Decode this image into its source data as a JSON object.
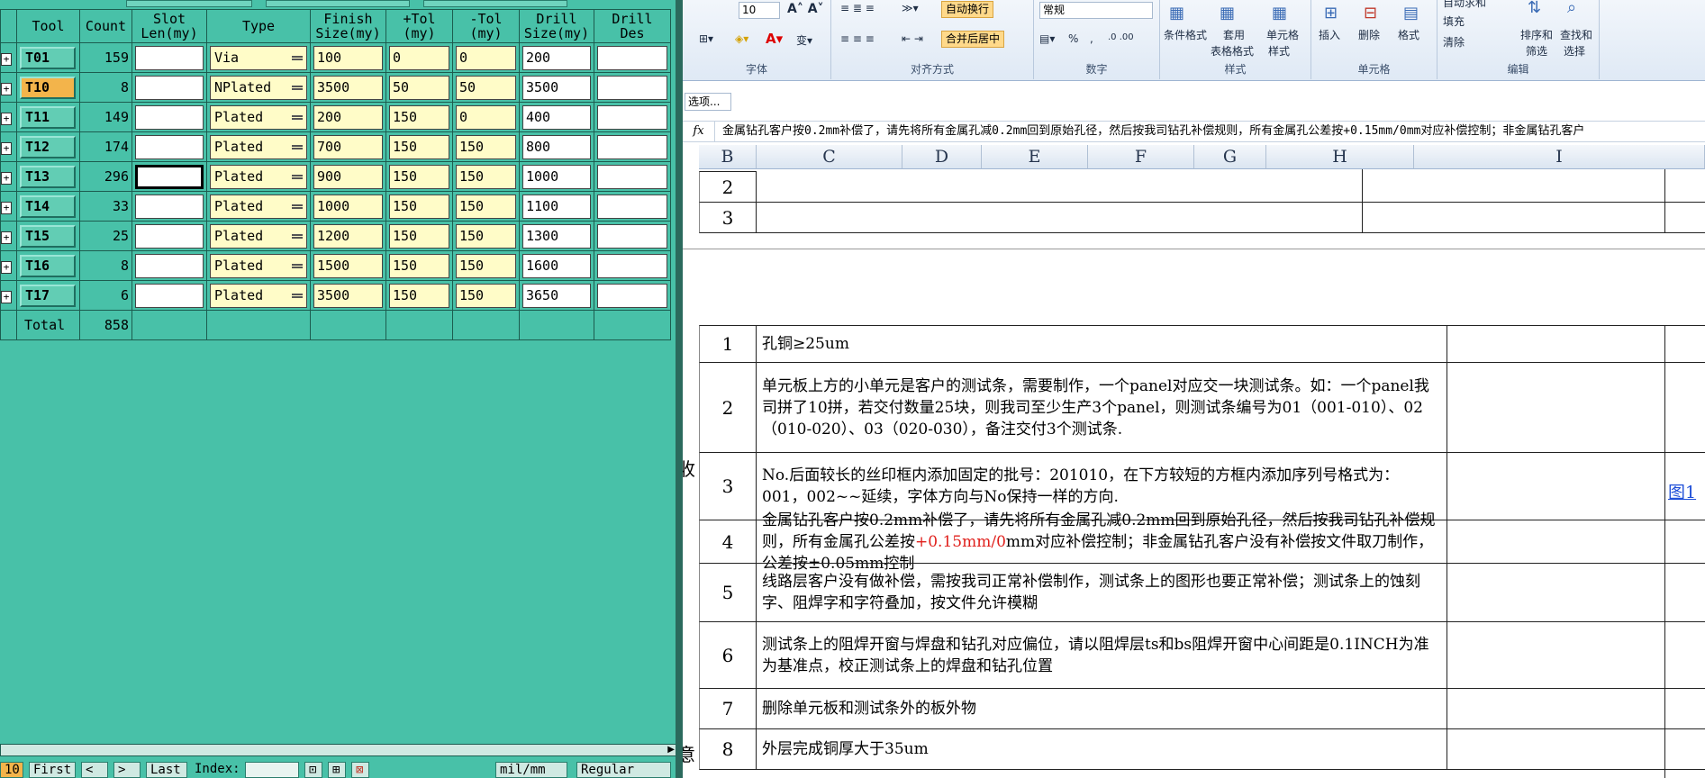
{
  "tool_table": {
    "headers": [
      "",
      "Tool",
      "Count",
      "Slot\nLen(my)",
      "Type",
      "Finish\nSize(my)",
      "+Tol\n(my)",
      "-Tol\n(my)",
      "Drill\nSize(my)",
      "Drill\nDes"
    ],
    "rows": [
      {
        "tool": "T01",
        "count": "159",
        "slot": "",
        "type": "Via",
        "finish": "100",
        "ptol": "0",
        "ntol": "0",
        "drill": "200",
        "des": ""
      },
      {
        "tool": "T10",
        "count": "8",
        "slot": "",
        "type": "NPlated",
        "finish": "3500",
        "ptol": "50",
        "ntol": "50",
        "drill": "3500",
        "des": ""
      },
      {
        "tool": "T11",
        "count": "149",
        "slot": "",
        "type": "Plated",
        "finish": "200",
        "ptol": "150",
        "ntol": "0",
        "drill": "400",
        "des": ""
      },
      {
        "tool": "T12",
        "count": "174",
        "slot": "",
        "type": "Plated",
        "finish": "700",
        "ptol": "150",
        "ntol": "150",
        "drill": "800",
        "des": ""
      },
      {
        "tool": "T13",
        "count": "296",
        "slot": "",
        "type": "Plated",
        "finish": "900",
        "ptol": "150",
        "ntol": "150",
        "drill": "1000",
        "des": ""
      },
      {
        "tool": "T14",
        "count": "33",
        "slot": "",
        "type": "Plated",
        "finish": "1000",
        "ptol": "150",
        "ntol": "150",
        "drill": "1100",
        "des": ""
      },
      {
        "tool": "T15",
        "count": "25",
        "slot": "",
        "type": "Plated",
        "finish": "1200",
        "ptol": "150",
        "ntol": "150",
        "drill": "1300",
        "des": ""
      },
      {
        "tool": "T16",
        "count": "8",
        "slot": "",
        "type": "Plated",
        "finish": "1500",
        "ptol": "150",
        "ntol": "150",
        "drill": "1600",
        "des": ""
      },
      {
        "tool": "T17",
        "count": "6",
        "slot": "",
        "type": "Plated",
        "finish": "3500",
        "ptol": "150",
        "ntol": "150",
        "drill": "3650",
        "des": ""
      }
    ],
    "selected_tool": "T10",
    "total_label": "Total",
    "total_count": "858"
  },
  "bottom_bar": {
    "page": "10",
    "first": "First",
    "prev": "<",
    "next": ">",
    "last": "Last",
    "index_label": "Index:",
    "unit": "mil/mm",
    "mode": "Regular"
  },
  "excel": {
    "ribbon": {
      "font_size": "10",
      "wrap_text": "自动换行",
      "merge_center": "合并后居中",
      "number_format": "常规",
      "percent": "%",
      "comma": ",",
      "cond_format": "条件格式",
      "table_format": [
        "套用",
        "表格格式"
      ],
      "cell_style": [
        "单元格",
        "样式"
      ],
      "insert": "插入",
      "delete": "删除",
      "format": "格式",
      "fill": "填充",
      "clear": "清除",
      "sort_filter": [
        "排序和",
        "筛选"
      ],
      "find_select": [
        "查找和",
        "选择"
      ],
      "autosum": "自动求和",
      "groups": {
        "font": "字体",
        "alignment": "对齐方式",
        "number": "数字",
        "styles": "样式",
        "cells": "单元格",
        "editing": "编辑"
      }
    },
    "name_box": "选项...",
    "formula_bar": "金属钻孔客户按0.2mm补偿了，请先将所有金属孔减0.2mm回到原始孔径，然后按我司钻孔补偿规则，所有金属孔公差按+0.15mm/0mm对应补偿控制；非金属钻孔客户",
    "columns": [
      "B",
      "C",
      "D",
      "E",
      "F",
      "G",
      "H",
      "I"
    ],
    "top_rows": [
      "2",
      "3"
    ],
    "rows": [
      {
        "n": "1",
        "text": "孔铜≥25um"
      },
      {
        "n": "2",
        "text": "单元板上方的小单元是客户的测试条，需要制作，一个panel对应交一块测试条。如：一个panel我司拼了10拼，若交付数量25块，则我司至少生产3个panel，则测试条编号为01（001-010）、02（010-020）、03（020-030），备注交付3个测试条."
      },
      {
        "n": "3",
        "text": "No.后面较长的丝印框内添加固定的批号：201010，在下方较短的方框内添加序列号格式为：001，002~~延续，字体方向与No保持一样的方向."
      },
      {
        "n": "4",
        "text_before": "金属钻孔客户按0.2mm补偿了，请先将所有金属孔减0.2mm回到原始孔径，然后按我司钻孔补偿规则，所有金属孔公差按",
        "text_red": "+0.15mm/0",
        "text_after": "mm对应补偿控制；非金属钻孔客户没有补偿按文件取刀制作，公差按±0.05mm控制"
      },
      {
        "n": "5",
        "text": "线路层客户没有做补偿，需按我司正常补偿制作，测试条上的图形也要正常补偿；测试条上的蚀刻字、阻焊字和字符叠加，按文件允许模糊"
      },
      {
        "n": "6",
        "text": "测试条上的阻焊开窗与焊盘和钻孔对应偏位，请以阻焊层ts和bs阻焊开窗中心间距是0.1INCH为准为基准点，校正测试条上的焊盘和钻孔位置"
      },
      {
        "n": "7",
        "text": "删除单元板和测试条外的板外物"
      },
      {
        "n": "8",
        "text": "外层完成铜厚大于35um"
      }
    ],
    "link_text": "图1",
    "edge_char_1": "收",
    "edge_char_2": "意"
  }
}
